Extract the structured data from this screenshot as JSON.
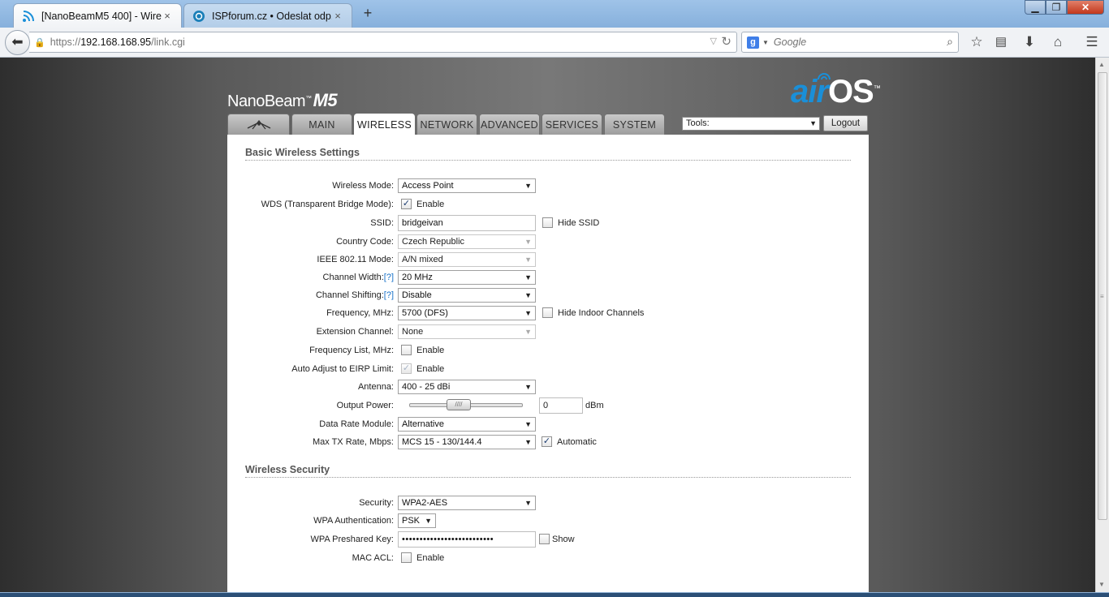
{
  "browser": {
    "tabs": [
      {
        "label": "[NanoBeamM5 400] - Wirel...",
        "close": "×"
      },
      {
        "label": "ISPforum.cz • Odeslat odp...",
        "close": "×"
      }
    ],
    "new_tab": "+",
    "window": {
      "minimize": "▁",
      "maximize": "❐",
      "close": "✕"
    },
    "url": {
      "scheme": "https://",
      "host": "192.168.168.95",
      "path": "/link.cgi"
    },
    "search": {
      "engine_letter": "g",
      "placeholder": "Google"
    },
    "icons": [
      "back-arrow-icon",
      "lock-icon",
      "reload-icon",
      "search-icon",
      "bookmark-star-icon",
      "reading-list-icon",
      "downloads-icon",
      "home-icon",
      "menu-icon"
    ]
  },
  "header": {
    "brand": "NanoBeam",
    "brand_tm": "™",
    "model": "M5",
    "logo_air": "air",
    "logo_os": "OS",
    "logo_tm": "™"
  },
  "nav": {
    "tabs": [
      "MAIN",
      "WIRELESS",
      "NETWORK",
      "ADVANCED",
      "SERVICES",
      "SYSTEM"
    ],
    "active": "WIRELESS",
    "tools_value": "Tools:",
    "logout_label": "Logout"
  },
  "basic": {
    "title": "Basic Wireless Settings",
    "wireless_mode": {
      "label": "Wireless Mode:",
      "value": "Access Point"
    },
    "wds": {
      "label": "WDS (Transparent Bridge Mode):",
      "option": "Enable",
      "checked": true
    },
    "ssid": {
      "label": "SSID:",
      "value": "bridgeivan",
      "hide_label": "Hide SSID",
      "hide_checked": false
    },
    "country": {
      "label": "Country Code:",
      "value": "Czech Republic"
    },
    "ieee_mode": {
      "label": "IEEE 802.11 Mode:",
      "value": "A/N mixed"
    },
    "channel_width": {
      "label": "Channel Width:",
      "help": "[?]",
      "value": "20 MHz"
    },
    "channel_shifting": {
      "label": "Channel Shifting:",
      "help": "[?]",
      "value": "Disable"
    },
    "frequency": {
      "label": "Frequency, MHz:",
      "value": "5700 (DFS)",
      "hide_indoor_label": "Hide Indoor Channels",
      "hide_indoor_checked": false
    },
    "extension_channel": {
      "label": "Extension Channel:",
      "value": "None"
    },
    "frequency_list": {
      "label": "Frequency List, MHz:",
      "option": "Enable",
      "checked": false
    },
    "auto_eirp": {
      "label": "Auto Adjust to EIRP Limit:",
      "option": "Enable",
      "checked": true
    },
    "antenna": {
      "label": "Antenna:",
      "value": "400 - 25 dBi"
    },
    "output_power": {
      "label": "Output Power:",
      "value": "0",
      "unit": "dBm"
    },
    "data_rate_module": {
      "label": "Data Rate Module:",
      "value": "Alternative"
    },
    "max_tx_rate": {
      "label": "Max TX Rate, Mbps:",
      "value": "MCS 15 - 130/144.4",
      "auto_label": "Automatic",
      "auto_checked": true
    }
  },
  "security": {
    "title": "Wireless Security",
    "security": {
      "label": "Security:",
      "value": "WPA2-AES"
    },
    "wpa_auth": {
      "label": "WPA Authentication:",
      "value": "PSK"
    },
    "wpa_key": {
      "label": "WPA Preshared Key:",
      "value": "••••••••••••••••••••••••••",
      "show_label": "Show",
      "show_checked": false
    },
    "mac_acl": {
      "label": "MAC ACL:",
      "option": "Enable",
      "checked": false
    }
  }
}
